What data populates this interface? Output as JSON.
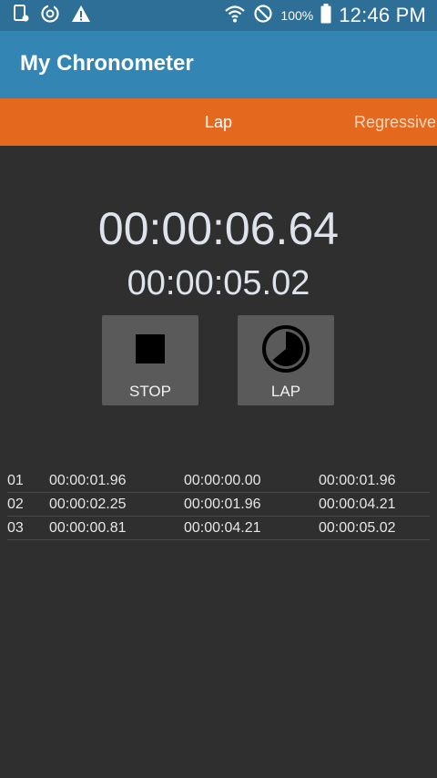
{
  "status_bar": {
    "battery": "100%",
    "time": "12:46 PM"
  },
  "app": {
    "title": "My Chronometer"
  },
  "tabs": [
    {
      "label": "Lap"
    },
    {
      "label": "Regressive"
    }
  ],
  "timer": {
    "total": "00:00:06.64",
    "lap": "00:00:05.02"
  },
  "buttons": {
    "stop_label": "STOP",
    "lap_label": "LAP"
  },
  "laps": [
    [
      "01",
      "00:00:01.96",
      "00:00:00.00",
      "00:00:01.96"
    ],
    [
      "02",
      "00:00:02.25",
      "00:00:01.96",
      "00:00:04.21"
    ],
    [
      "03",
      "00:00:00.81",
      "00:00:04.21",
      "00:00:05.02"
    ]
  ]
}
